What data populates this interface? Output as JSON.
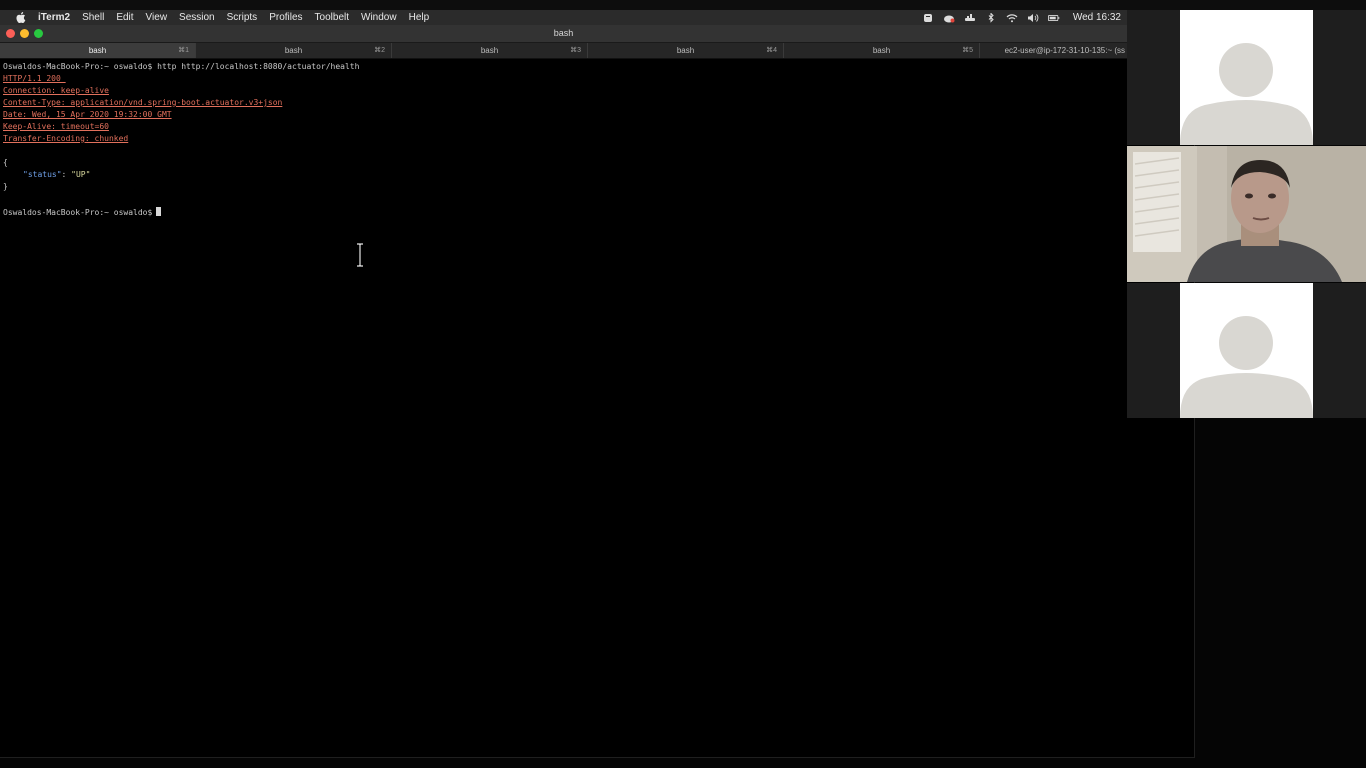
{
  "menubar": {
    "app_name": "iTerm2",
    "items": [
      "Shell",
      "Edit",
      "View",
      "Session",
      "Scripts",
      "Profiles",
      "Toolbelt",
      "Window",
      "Help"
    ],
    "clock": "Wed 16:32"
  },
  "window": {
    "title": "bash"
  },
  "tabs": [
    {
      "label": "bash",
      "shortcut": "⌘1",
      "active": true
    },
    {
      "label": "bash",
      "shortcut": "⌘2"
    },
    {
      "label": "bash",
      "shortcut": "⌘3"
    },
    {
      "label": "bash",
      "shortcut": "⌘4"
    },
    {
      "label": "bash",
      "shortcut": "⌘5"
    },
    {
      "label": "ec2-user@ip-172-31-10-135:~ (ss"
    }
  ],
  "terminal": {
    "prompt": "Oswaldos-MacBook-Pro:~ oswaldo$",
    "command": "http http://localhost:8080/actuator/health",
    "headers": [
      "HTTP/1.1 200 ",
      "Connection: keep-alive",
      "Content-Type: application/vnd.spring-boot.actuator.v3+json",
      "Date: Wed, 15 Apr 2020 19:32:00 GMT",
      "Keep-Alive: timeout=60",
      "Transfer-Encoding: chunked"
    ],
    "json_open": "{",
    "json_key": "\"status\"",
    "json_sep": ": ",
    "json_value": "\"UP\"",
    "json_close": "}"
  },
  "icons": {
    "apple": "apple-icon",
    "status": [
      "evernote-icon",
      "creative-cloud-icon",
      "docker-icon",
      "bluetooth-icon",
      "wifi-icon",
      "volume-icon",
      "battery-icon"
    ],
    "pointer": "text-cursor-icon"
  }
}
